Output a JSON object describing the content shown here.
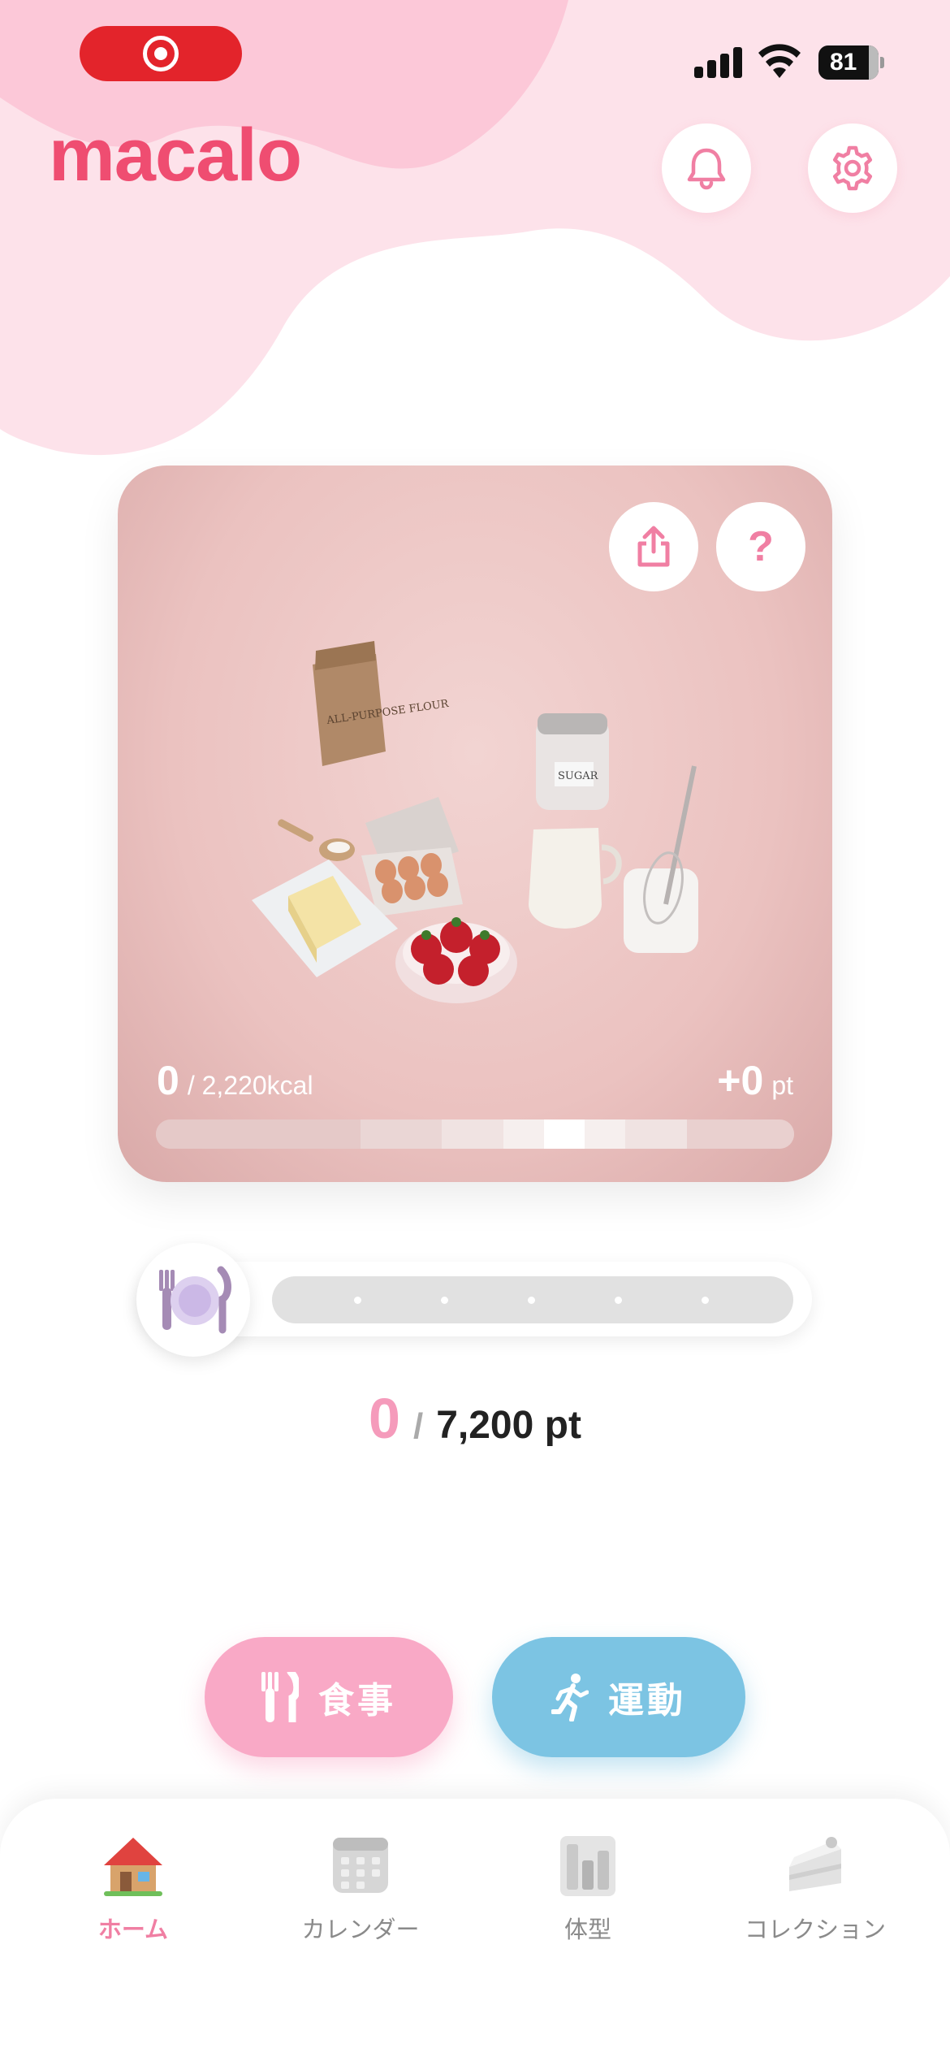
{
  "status_bar": {
    "battery": "81"
  },
  "app": {
    "logo": "macalo"
  },
  "header": {
    "icons": [
      "bell-icon",
      "gear-icon"
    ]
  },
  "card": {
    "calories_consumed": "0",
    "calories_goal": "/ 2,220kcal",
    "points_earned": "+0",
    "points_unit": "pt",
    "ingredient_labels": [
      "ALL-PURPOSE FLOUR",
      "SUGAR"
    ]
  },
  "points": {
    "current": "0",
    "separator": "/",
    "goal": "7,200 pt"
  },
  "actions": {
    "meal_label": "食事",
    "exercise_label": "運動"
  },
  "tabs": [
    {
      "label": "ホーム",
      "icon": "house-icon",
      "active": true
    },
    {
      "label": "カレンダー",
      "icon": "calendar-icon",
      "active": false
    },
    {
      "label": "体型",
      "icon": "body-chart-icon",
      "active": false
    },
    {
      "label": "コレクション",
      "icon": "cake-icon",
      "active": false
    }
  ],
  "colors": {
    "brand_pink": "#ef4d71",
    "meal_pink": "#f9a9c6",
    "exercise_blue": "#7cc4e3",
    "record_red": "#e3242b"
  }
}
